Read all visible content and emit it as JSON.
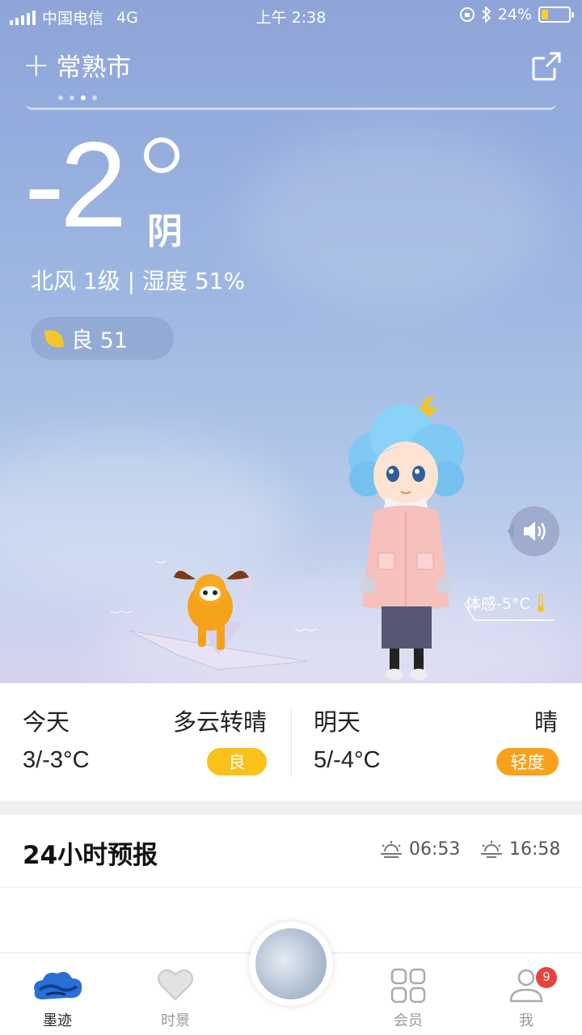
{
  "status_bar": {
    "carrier": "中国电信",
    "network": "4G",
    "time": "上午 2:38",
    "battery_percent": "24%",
    "battery_level": 0.24
  },
  "header": {
    "city": "常熟市",
    "page_dots": 4,
    "active_page": 3
  },
  "current": {
    "temperature": "-2",
    "condition": "阴",
    "wind_humidity": "北风 1级 | 湿度 51%",
    "aqi_text": "良 51",
    "feels_like": "体感-5°C"
  },
  "forecast": {
    "today": {
      "label": "今天",
      "condition": "多云转晴",
      "range": "3/-3°C",
      "aqi": "良",
      "aqi_color": "#f8c21a"
    },
    "tomorrow": {
      "label": "明天",
      "condition": "晴",
      "range": "5/-4°C",
      "aqi": "轻度",
      "aqi_color": "#f7a11c"
    }
  },
  "hourly": {
    "title": "24小时预报",
    "sunrise": "06:53",
    "sunset": "16:58"
  },
  "tabs": {
    "items": [
      {
        "label": "墨迹",
        "icon": "moji-cloud-icon",
        "active": true
      },
      {
        "label": "时景",
        "icon": "heart-icon",
        "active": false
      },
      {
        "label": "会员",
        "icon": "grid-icon",
        "active": false
      },
      {
        "label": "我",
        "icon": "user-icon",
        "active": false
      }
    ],
    "badge": "9"
  },
  "colors": {
    "accent_blue": "#2a6fd6",
    "badge_red": "#e8423d"
  }
}
